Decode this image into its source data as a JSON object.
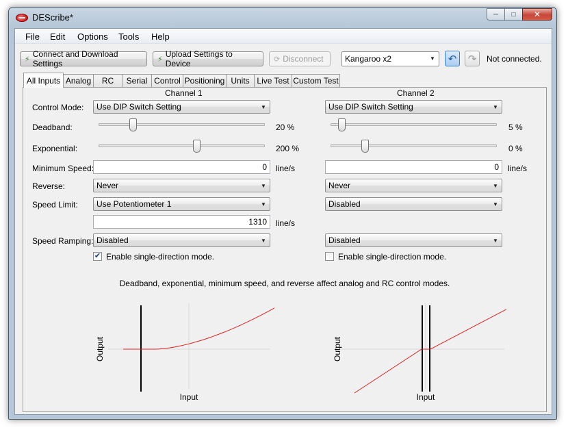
{
  "window": {
    "title": "DEScribe*",
    "buttons": {
      "minimize": "─",
      "maximize": "□",
      "close": "✕"
    }
  },
  "menu": [
    "File",
    "Edit",
    "Options",
    "Tools",
    "Help"
  ],
  "toolbar": {
    "connect_label": "Connect and Download Settings",
    "upload_label": "Upload Settings to Device",
    "disconnect_label": "Disconnect",
    "device_selected": "Kangaroo x2",
    "status": "Not connected."
  },
  "tabs": [
    "All Inputs",
    "Analog",
    "RC",
    "Serial",
    "Control",
    "Positioning",
    "Units",
    "Live Test",
    "Custom Test"
  ],
  "active_tab": "All Inputs",
  "labels": {
    "channel1": "Channel 1",
    "channel2": "Channel 2",
    "control_mode": "Control Mode:",
    "deadband": "Deadband:",
    "exponential": "Exponential:",
    "min_speed": "Minimum Speed:",
    "reverse": "Reverse:",
    "speed_limit": "Speed Limit:",
    "speed_ramping": "Speed Ramping:",
    "single_direction": "Enable single-direction mode.",
    "note": "Deadband, exponential, minimum speed, and reverse affect analog and RC control modes.",
    "graph_output": "Output",
    "graph_input": "Input"
  },
  "channel1": {
    "control_mode": "Use DIP Switch Setting",
    "deadband": "20 %",
    "deadband_value": 20,
    "exponential": "200 %",
    "exponential_value": 200,
    "min_speed": "0",
    "min_speed_unit": "line/s",
    "reverse": "Never",
    "speed_limit": "Use Potentiometer 1",
    "speed_limit_value": "1310",
    "speed_limit_unit": "line/s",
    "speed_ramping": "Disabled",
    "single_direction": true
  },
  "channel2": {
    "control_mode": "Use DIP Switch Setting",
    "deadband": "5 %",
    "deadband_value": 5,
    "exponential": "0 %",
    "exponential_value": 0,
    "min_speed": "0",
    "min_speed_unit": "line/s",
    "reverse": "Never",
    "speed_limit": "Disabled",
    "speed_ramping": "Disabled",
    "single_direction": false
  },
  "colors": {
    "curve": "#e02020",
    "accent": "#3a7bc8"
  }
}
